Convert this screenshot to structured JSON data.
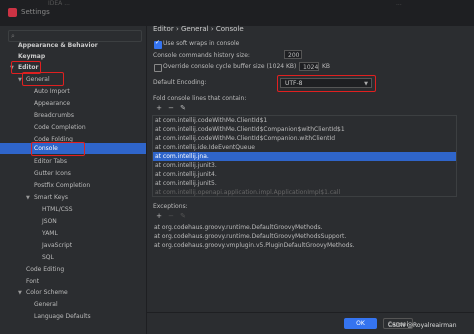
{
  "window": {
    "title": "Settings",
    "faded_left": "IDEA ...",
    "faded_right": "..."
  },
  "search": {
    "placeholder": ""
  },
  "tree": [
    {
      "label": "Appearance & Behavior",
      "bold": true
    },
    {
      "label": "Keymap",
      "bold": true
    },
    {
      "label": "Editor",
      "bold": true
    },
    {
      "label": "General"
    },
    {
      "label": "Auto Import"
    },
    {
      "label": "Appearance"
    },
    {
      "label": "Breadcrumbs"
    },
    {
      "label": "Code Completion"
    },
    {
      "label": "Code Folding"
    },
    {
      "label": "Console",
      "selected": true
    },
    {
      "label": "Editor Tabs"
    },
    {
      "label": "Gutter Icons"
    },
    {
      "label": "Postfix Completion"
    },
    {
      "label": "Smart Keys"
    },
    {
      "label": "HTML/CSS"
    },
    {
      "label": "JSON"
    },
    {
      "label": "YAML"
    },
    {
      "label": "JavaScript"
    },
    {
      "label": "SQL"
    },
    {
      "label": "Code Editing"
    },
    {
      "label": "Font"
    },
    {
      "label": "Color Scheme"
    },
    {
      "label": "General"
    },
    {
      "label": "Language Defaults"
    }
  ],
  "breadcrumb": {
    "part1": "Editor",
    "sep": "›",
    "part2": "General",
    "part3": "Console"
  },
  "soft_wraps": {
    "label": "Use soft wraps in console",
    "checked": true
  },
  "history_size": {
    "label": "Console commands history size:",
    "value": "200"
  },
  "cycle_buffer": {
    "label": "Override console cycle buffer size (1024 KB)",
    "value": "1024",
    "unit": "KB",
    "checked": false
  },
  "encoding": {
    "label": "Default Encoding:",
    "value": "UTF-8"
  },
  "fold_section": {
    "label": "Fold console lines that contain:"
  },
  "fold_lines": [
    "at com.intellij.codeWithMe.ClientId$1",
    "at com.intellij.codeWithMe.ClientId$Companion$withClientId$1",
    "at com.intellij.codeWithMe.ClientId$Companion.withClientId",
    "at com.intellij.ide.IdeEventQueue",
    "at com.intellij.jna.",
    "at com.intellij.junit3.",
    "at com.intellij.junit4.",
    "at com.intellij.junit5.",
    "at com.intellij.openapi.application.impl.ApplicationImpl$1.call"
  ],
  "exceptions": {
    "label": "Exceptions:"
  },
  "exception_lines": [
    "at org.codehaus.groovy.runtime.DefaultGroovyMethods.",
    "at org.codehaus.groovy.runtime.DefaultGroovyMethodsSupport.",
    "at org.codehaus.groovy.vmplugin.v5.PluginDefaultGroovyMethods."
  ],
  "buttons": {
    "ok": "OK",
    "cancel": "Cancel"
  },
  "watermark": "CSDN @Royalreairman"
}
